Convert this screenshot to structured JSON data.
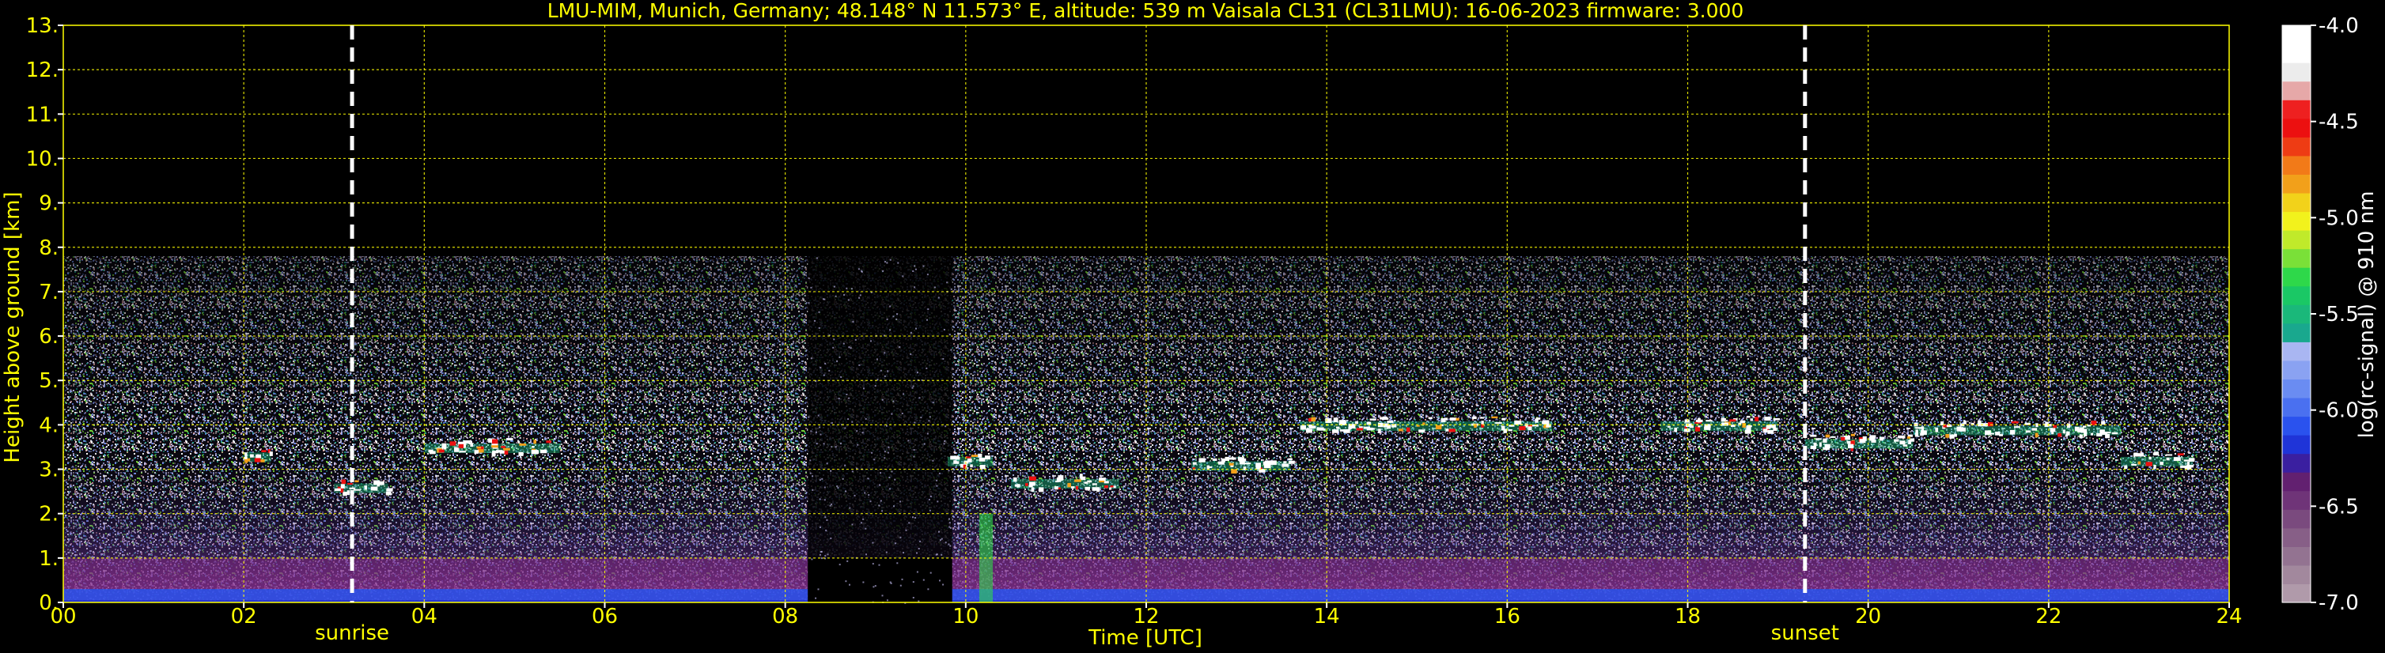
{
  "chart_data": {
    "type": "heatmap",
    "title": "LMU-MIM, Munich, Germany; 48.148° N 11.573° E, altitude: 539 m    Vaisala CL31 (CL31LMU): 16-06-2023    firmware: 3.000",
    "xlabel": "Time [UTC]",
    "ylabel": "Height above ground [km]",
    "xlim": [
      0,
      24
    ],
    "ylim": [
      0,
      13
    ],
    "x_ticks": [
      "00",
      "02",
      "04",
      "06",
      "08",
      "10",
      "12",
      "14",
      "16",
      "18",
      "20",
      "22",
      "24"
    ],
    "y_ticks": [
      "0.",
      "1.",
      "2.",
      "3.",
      "4.",
      "5.",
      "6.",
      "7.",
      "8.",
      "9.",
      "10.",
      "11.",
      "12.",
      "13."
    ],
    "grid": true,
    "signal_top_km": 7.8,
    "data_gap_hours": [
      8.25,
      9.85
    ],
    "markers": [
      {
        "label": "sunrise",
        "hour": 3.2
      },
      {
        "label": "sunset",
        "hour": 19.3
      }
    ],
    "cloud_layers": [
      {
        "start": 2.0,
        "end": 2.3,
        "base_km": 3.2
      },
      {
        "start": 3.0,
        "end": 3.6,
        "base_km": 2.5
      },
      {
        "start": 4.0,
        "end": 5.5,
        "base_km": 3.4
      },
      {
        "start": 9.8,
        "end": 10.3,
        "base_km": 3.1
      },
      {
        "start": 10.5,
        "end": 11.7,
        "base_km": 2.6
      },
      {
        "start": 12.5,
        "end": 13.6,
        "base_km": 3.0
      },
      {
        "start": 13.7,
        "end": 16.5,
        "base_km": 3.9
      },
      {
        "start": 17.7,
        "end": 19.0,
        "base_km": 3.9
      },
      {
        "start": 19.3,
        "end": 20.5,
        "base_km": 3.5
      },
      {
        "start": 20.5,
        "end": 22.8,
        "base_km": 3.8
      },
      {
        "start": 22.8,
        "end": 23.6,
        "base_km": 3.1
      }
    ],
    "colorbar": {
      "label": "log(rc-signal) @ 910 nm",
      "range": [
        -7.0,
        -4.0
      ],
      "ticks": [
        "-4.0",
        "-4.5",
        "-5.0",
        "-5.5",
        "-6.0",
        "-6.5",
        "-7.0"
      ],
      "colors": [
        "#b09aaa",
        "#a2889d",
        "#937391",
        "#875f87",
        "#7a4a7e",
        "#6f3478",
        "#622070",
        "#3a1fa0",
        "#1f34d8",
        "#2a52ee",
        "#4a70f0",
        "#6a8cf2",
        "#8aa2f2",
        "#a9b6f2",
        "#19a88e",
        "#1ab87a",
        "#1ac865",
        "#2ed84a",
        "#7ae038",
        "#c0ea2a",
        "#f2f21c",
        "#f2d21a",
        "#f2a01a",
        "#f27a18",
        "#ee3c14",
        "#ec1010",
        "#ee2020",
        "#e6a8a8",
        "#ececec",
        "#ffffff",
        "#ffffff"
      ]
    }
  }
}
